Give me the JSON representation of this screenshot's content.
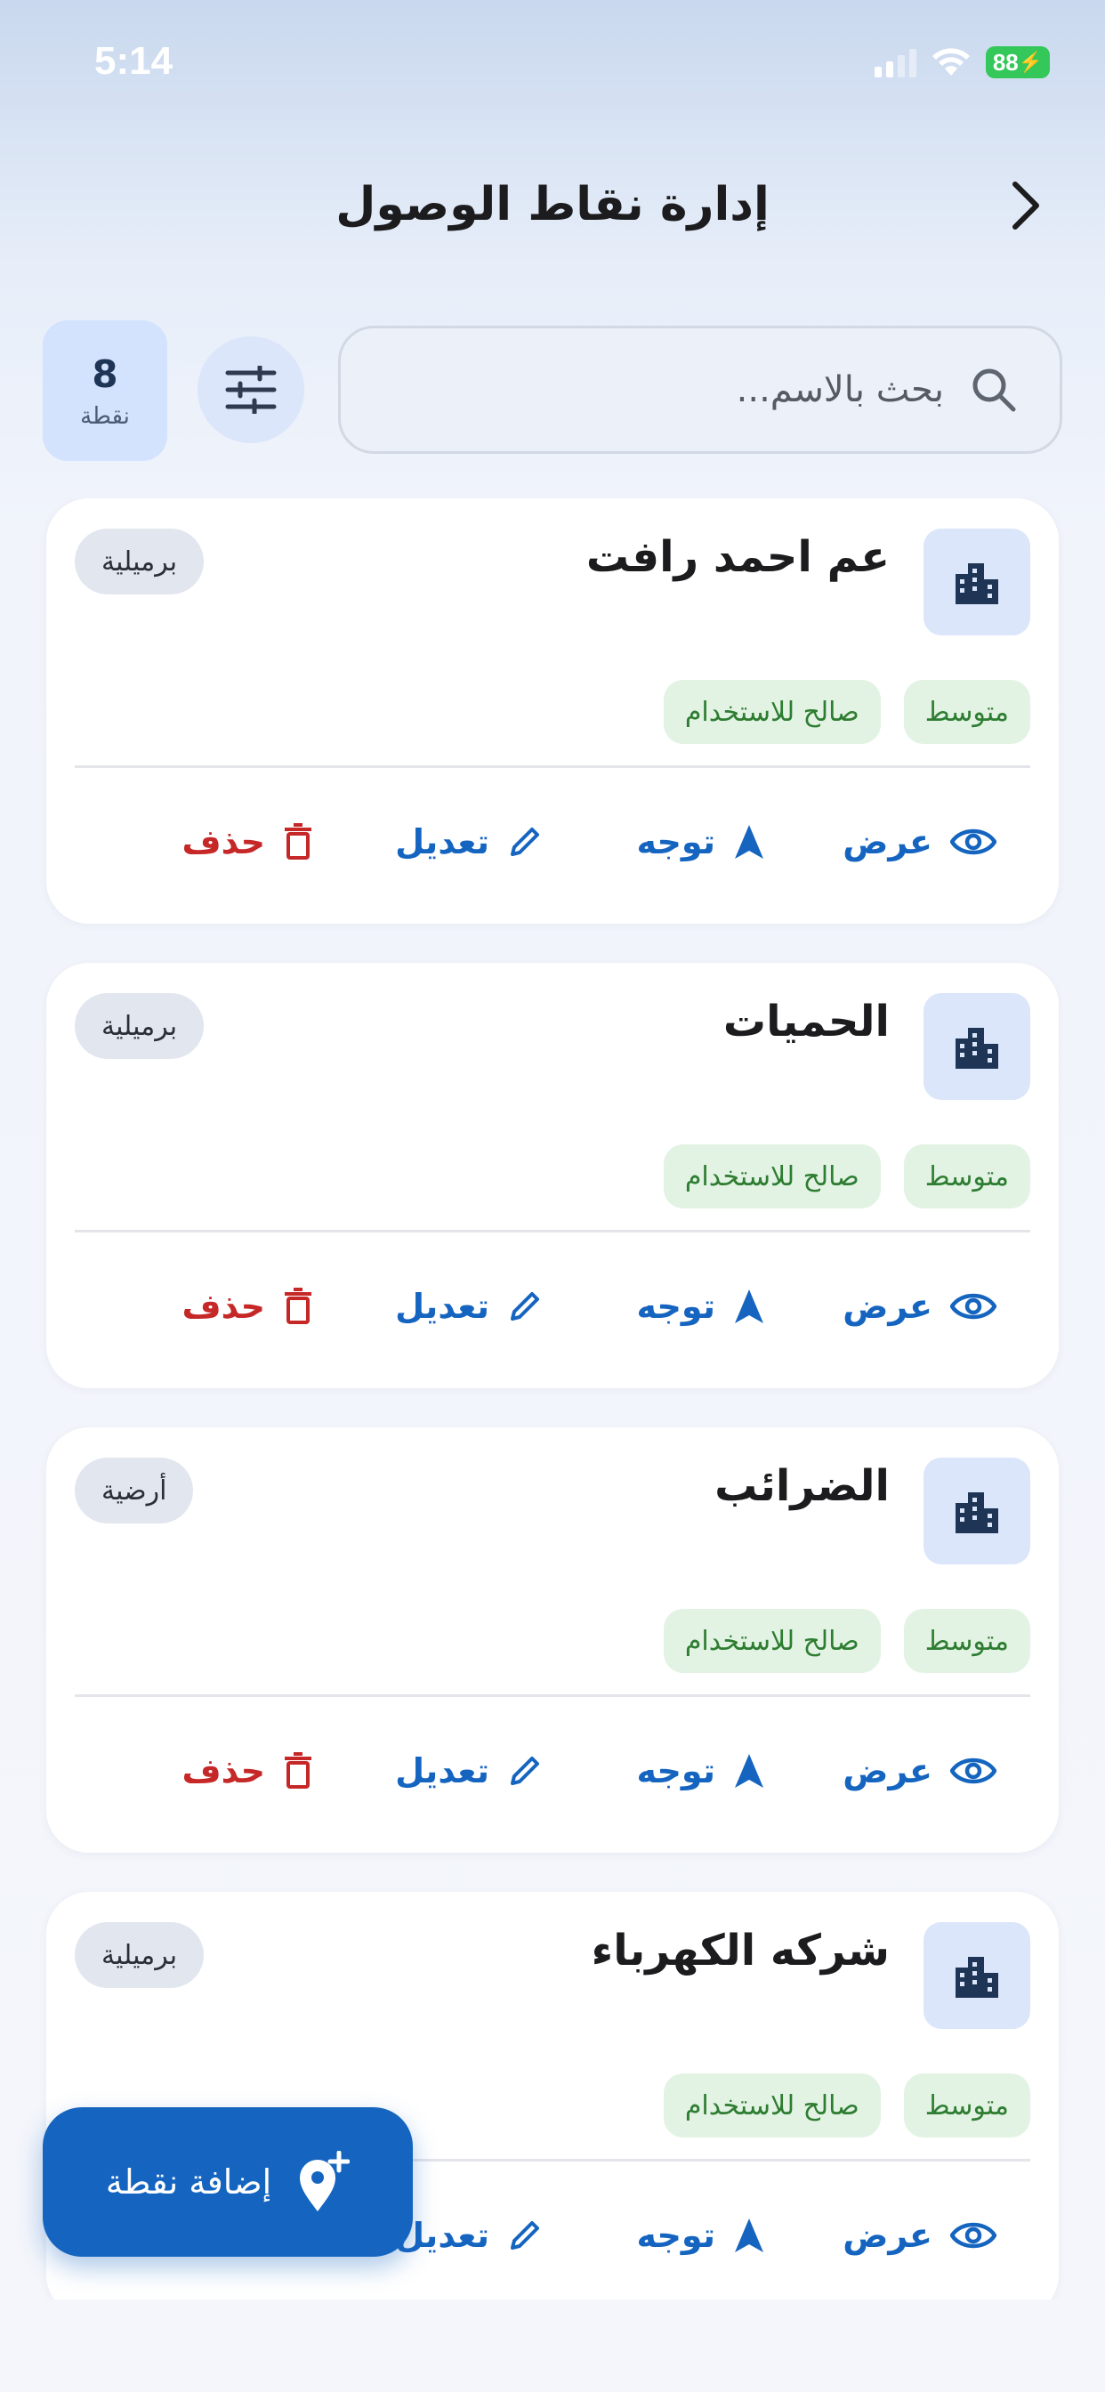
{
  "status_bar": {
    "time": "5:14",
    "battery": "88"
  },
  "header": {
    "title": "إدارة نقاط الوصول",
    "back_icon": "chevron-right-icon"
  },
  "search": {
    "placeholder": "بحث بالاسم..."
  },
  "count": {
    "value": "8",
    "label": "نقطة"
  },
  "actions": {
    "view": "عرض",
    "navigate": "توجه",
    "edit": "تعديل",
    "delete": "حذف"
  },
  "points": [
    {
      "name": "عم احمد رافت",
      "type": "برميلية",
      "tags": [
        "متوسط",
        "صالح للاستخدام"
      ]
    },
    {
      "name": "الحميات",
      "type": "برميلية",
      "tags": [
        "متوسط",
        "صالح للاستخدام"
      ]
    },
    {
      "name": "الضرائب",
      "type": "أرضية",
      "tags": [
        "متوسط",
        "صالح للاستخدام"
      ]
    },
    {
      "name": "شركه الكهرباء",
      "type": "برميلية",
      "tags": [
        "متوسط",
        "صالح للاستخدام"
      ]
    }
  ],
  "fab": {
    "label": "إضافة نقطة",
    "icon": "add-location-icon"
  },
  "colors": {
    "primary": "#1565c0",
    "danger": "#c62828",
    "success_text": "#2e7d32",
    "success_bg": "#e2f3e3",
    "chip_bg": "#dbe6fb"
  }
}
